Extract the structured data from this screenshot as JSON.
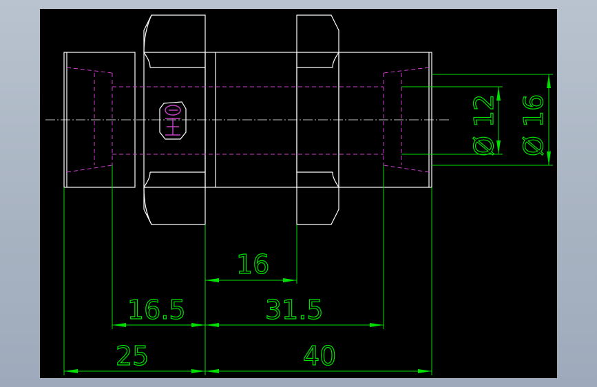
{
  "drawing": {
    "background": "#000000",
    "line_color": "#ffffff",
    "hidden_line_color": "#d23cd2",
    "dimension_color": "#00e000"
  },
  "dimensions": {
    "len_16": "16",
    "len_16_5": "16.5",
    "len_31_5": "31.5",
    "len_25": "25",
    "len_40": "40",
    "dia_12": "Ø 12",
    "dia_16": "Ø 16"
  }
}
